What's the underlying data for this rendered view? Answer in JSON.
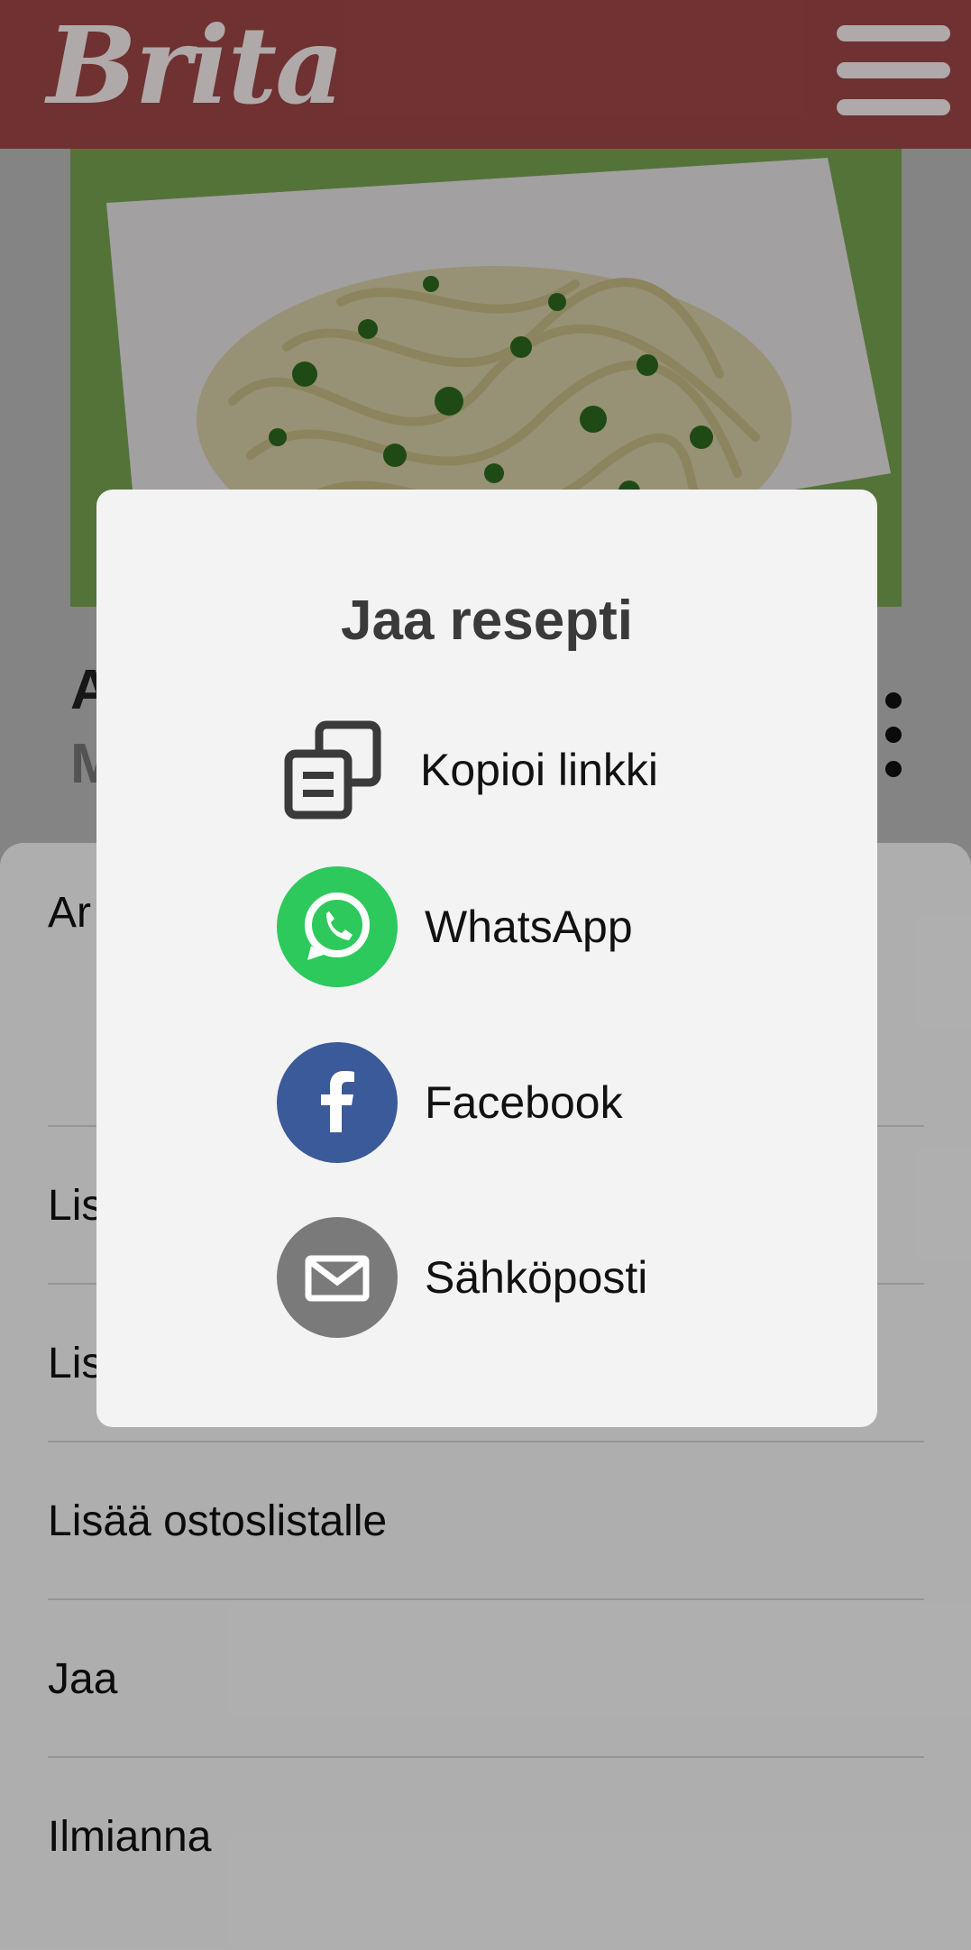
{
  "header": {
    "logo_text": "Brita",
    "brand_color": "#a04747",
    "menu_icon": "hamburger-icon"
  },
  "recipe": {
    "title_fragment": "A",
    "subtitle_fragment": "M"
  },
  "sheet": {
    "items": [
      {
        "label": "Ar"
      },
      {
        "label": "Lis"
      },
      {
        "label": "Lis"
      },
      {
        "label": "Lisää ostoslistalle"
      },
      {
        "label": "Jaa"
      },
      {
        "label": "Ilmianna"
      }
    ]
  },
  "share_dialog": {
    "title": "Jaa resepti",
    "options": [
      {
        "label": "Kopioi linkki",
        "icon": "copy-link-icon",
        "color": "#3a3a3a"
      },
      {
        "label": "WhatsApp",
        "icon": "whatsapp-icon",
        "color": "#2ec95c"
      },
      {
        "label": "Facebook",
        "icon": "facebook-icon",
        "color": "#3b5a9a"
      },
      {
        "label": "Sähköposti",
        "icon": "email-icon",
        "color": "#7a7a7a"
      }
    ]
  }
}
